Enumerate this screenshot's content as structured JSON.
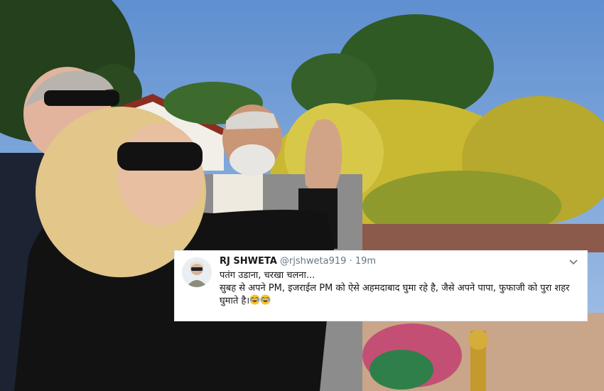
{
  "tweet": {
    "display_name": "RJ SHWETA",
    "handle": "@rjshweta919",
    "separator": "·",
    "time": "19m",
    "line1": "पतंग उडाना, चरखा चलना...",
    "line2": "सुबह से अपने PM, इजराईल PM को ऐसे अहमदाबाद घुमा रहे है, जैसे अपने पापा, फुफाजी को पुरा शहर घुमाते है।",
    "emojis": [
      "face-with-tears-of-joy-icon",
      "face-with-tears-of-joy-icon"
    ],
    "menu_icon": "chevron-down-icon"
  },
  "colors": {
    "sky": "#7aa4d6",
    "foliage_yellow": "#d6c53a",
    "foliage_green": "#2f5a24",
    "text_primary": "#14171a",
    "text_secondary": "#657786"
  }
}
